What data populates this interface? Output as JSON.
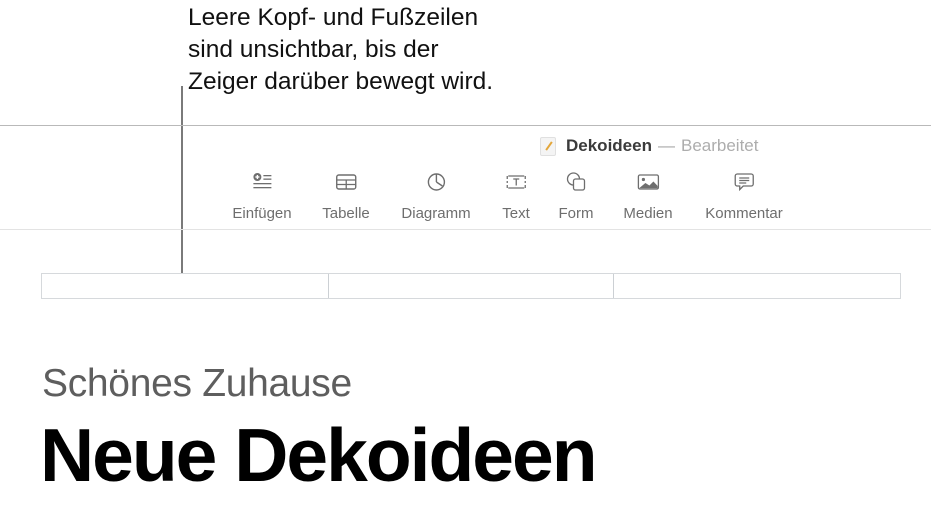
{
  "callout": {
    "text": "Leere Kopf- und Fußzeilen\nsind unsichtbar, bis der\nZeiger darüber bewegt wird."
  },
  "window": {
    "doc_icon": "pages-document-icon",
    "doc_name": "Dekoideen",
    "separator": "—",
    "status": "Bearbeitet"
  },
  "toolbar": {
    "items": [
      {
        "label": "Einfügen",
        "icon": "insert-icon"
      },
      {
        "label": "Tabelle",
        "icon": "table-icon"
      },
      {
        "label": "Diagramm",
        "icon": "chart-icon"
      },
      {
        "label": "Text",
        "icon": "textbox-icon"
      },
      {
        "label": "Form",
        "icon": "shape-icon"
      },
      {
        "label": "Medien",
        "icon": "media-icon"
      },
      {
        "label": "Kommentar",
        "icon": "comment-icon"
      }
    ]
  },
  "document": {
    "header_fields": [
      "",
      "",
      ""
    ],
    "subtitle": "Schönes Zuhause",
    "title": "Neue Dekoideen"
  }
}
